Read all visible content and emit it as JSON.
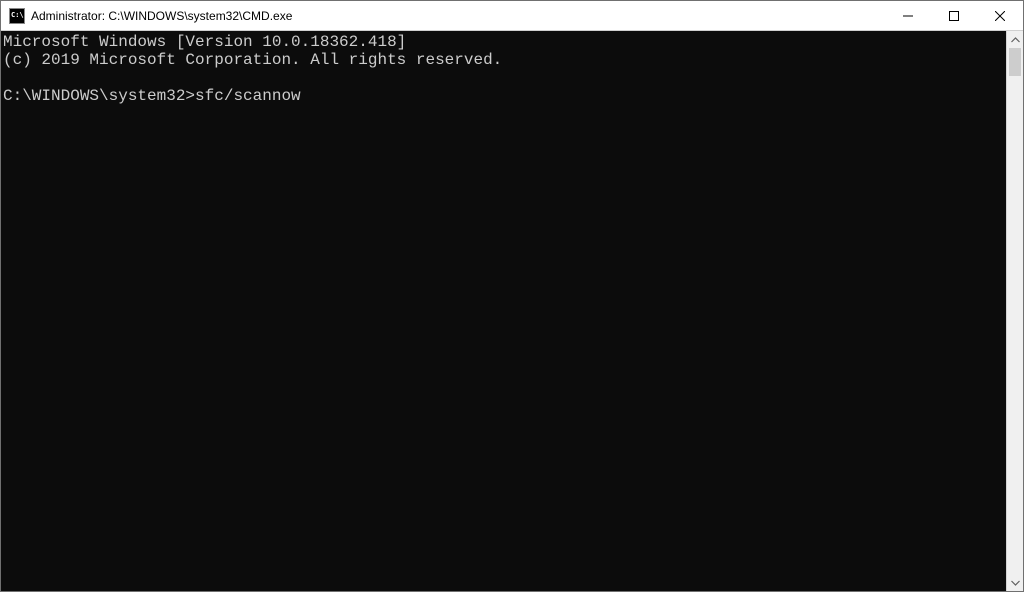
{
  "window": {
    "title": "Administrator: C:\\WINDOWS\\system32\\CMD.exe"
  },
  "terminal": {
    "line1": "Microsoft Windows [Version 10.0.18362.418]",
    "line2": "(c) 2019 Microsoft Corporation. All rights reserved.",
    "blank": "",
    "prompt": "C:\\WINDOWS\\system32>",
    "command": "sfc/scannow"
  },
  "icons": {
    "cmd": "cmd-icon",
    "minimize": "minimize-icon",
    "maximize": "maximize-icon",
    "close": "close-icon",
    "scroll_up": "chevron-up-icon",
    "scroll_down": "chevron-down-icon"
  }
}
